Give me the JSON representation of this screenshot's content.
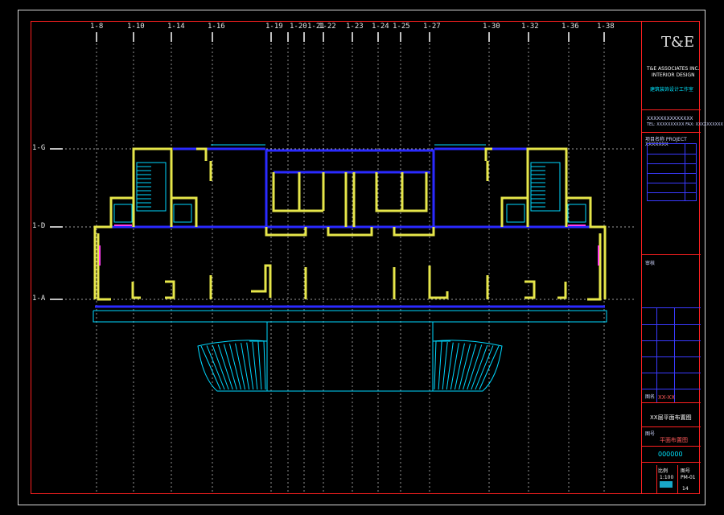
{
  "window": {
    "background": "#000000",
    "frame_color": "#ff2020",
    "border_color": "#d9d9d9"
  },
  "grid": {
    "vertical_axes": [
      {
        "label": "1-8"
      },
      {
        "label": "1-10"
      },
      {
        "label": "1-14"
      },
      {
        "label": "1-16"
      },
      {
        "label": "1-19"
      },
      {
        "label": "1-20"
      },
      {
        "label": "1-21"
      },
      {
        "label": "1-22"
      },
      {
        "label": "1-23"
      },
      {
        "label": "1-24"
      },
      {
        "label": "1-25"
      },
      {
        "label": "1-27"
      },
      {
        "label": "1-30"
      },
      {
        "label": "1-32"
      },
      {
        "label": "1-36"
      },
      {
        "label": "1-38"
      }
    ],
    "horizontal_axes": [
      {
        "label": "1-G"
      },
      {
        "label": "1-D"
      },
      {
        "label": "1-A"
      }
    ],
    "axis_color": "#d0d0d0"
  },
  "colors": {
    "wall": "#e6e64a",
    "beam": "#2a2aff",
    "detail": "#00d8ff",
    "accent": "#ff3df0"
  },
  "title_block": {
    "logo_text": "T&E",
    "company_line1": "T&E ASSOCIATES INC.",
    "company_line2": "INTERIOR DESIGN",
    "company_cn": "建筑装饰设计工作室",
    "address1": "XXXXXXXXXXXXXX",
    "address2": "TEL: XXXXXXXXXX FAX: XXXXXXXXXX",
    "project_label": "项目名称 PROJECT",
    "project_sub": "XXXXXXX",
    "review_label": "审核",
    "drawing_label": "图名",
    "drawing_name": "XX-XX",
    "drawing_title_cn": "XX层平面布置图",
    "drawing_sub": "平面布置图",
    "number_label": "图号",
    "number_value": "000000",
    "scale_label": "比例",
    "scale_value": "1:100",
    "sheet_label": "图号",
    "sheet_value": "PM-01",
    "rev": "14"
  }
}
